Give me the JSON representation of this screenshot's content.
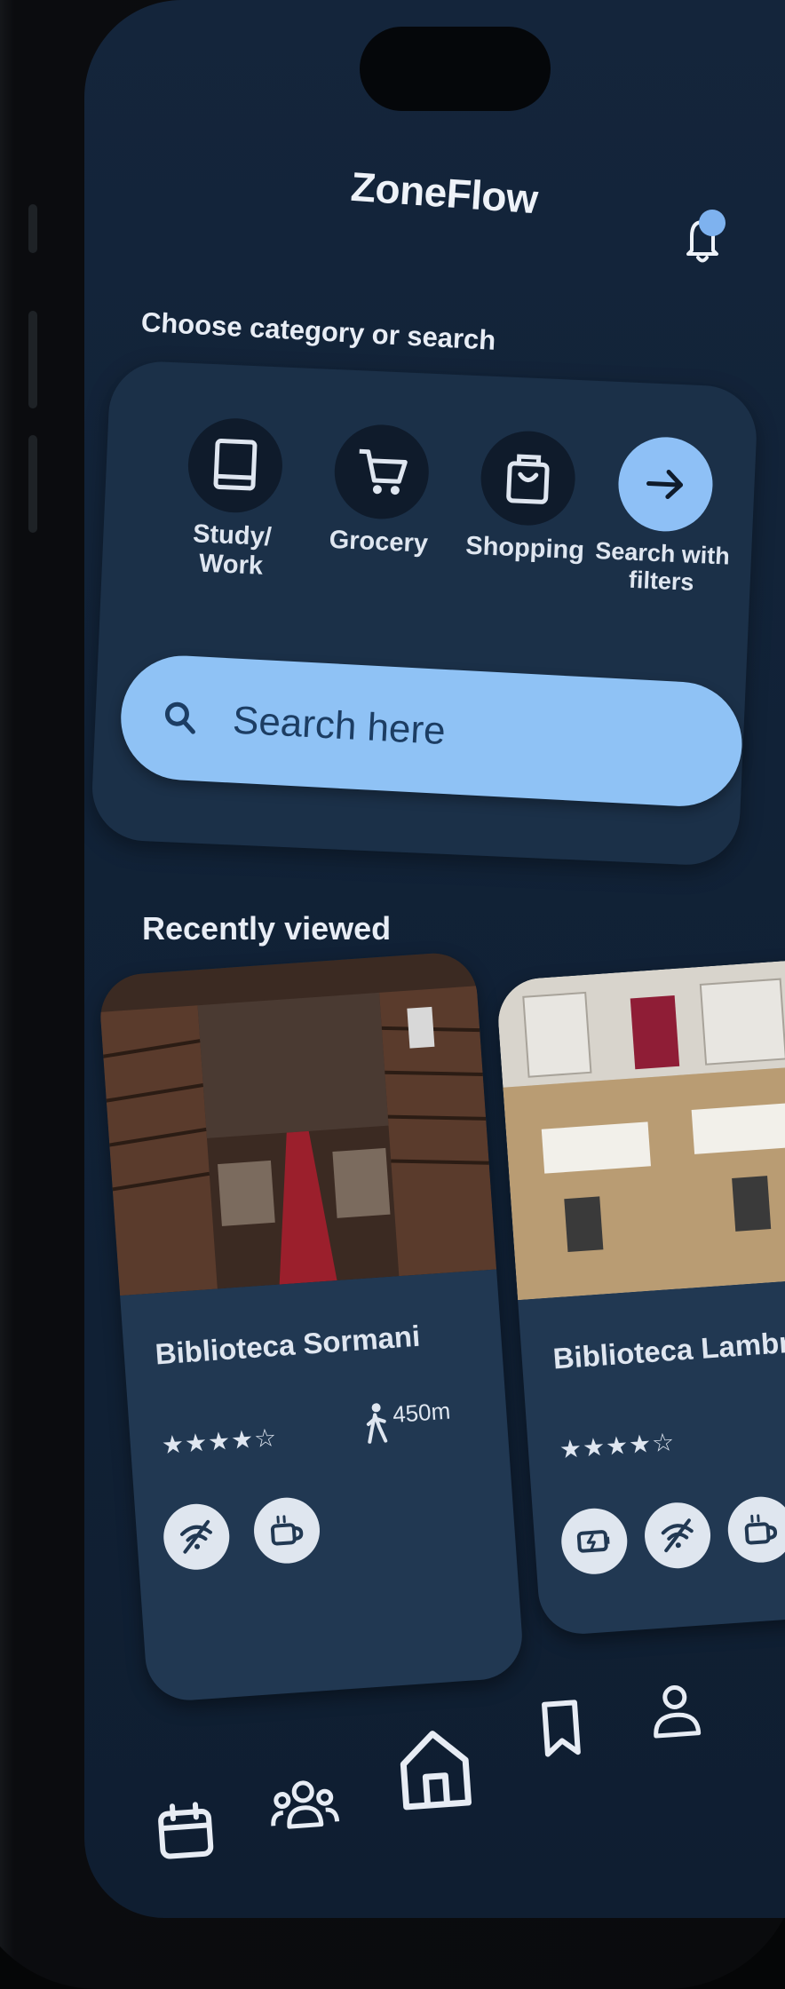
{
  "app": {
    "title": "ZoneFlow"
  },
  "categories": {
    "prompt": "Choose category or search",
    "items": [
      {
        "label": "Study/ Work",
        "icon": "book-icon"
      },
      {
        "label": "Grocery",
        "icon": "cart-icon"
      },
      {
        "label": "Shopping",
        "icon": "shopping-bag-icon"
      },
      {
        "label": "Search with filters",
        "icon": "arrow-right-icon"
      }
    ]
  },
  "search": {
    "placeholder": "Search here"
  },
  "recent": {
    "title": "Recently viewed",
    "cards": [
      {
        "name": "Biblioteca Sormani",
        "rating": "★★★★☆",
        "distance": "450m",
        "amenities": [
          "no-wifi-icon",
          "coffee-icon"
        ]
      },
      {
        "name": "Biblioteca Lambrate",
        "rating": "★★★★☆",
        "distance": "",
        "amenities": [
          "charging-icon",
          "no-wifi-icon",
          "coffee-icon"
        ]
      }
    ]
  },
  "nav": [
    "calendar-icon",
    "group-icon",
    "home-icon",
    "bookmark-icon",
    "profile-icon"
  ],
  "colors": {
    "accent": "#8fc2f5",
    "background": "#112237",
    "card": "#213852"
  }
}
